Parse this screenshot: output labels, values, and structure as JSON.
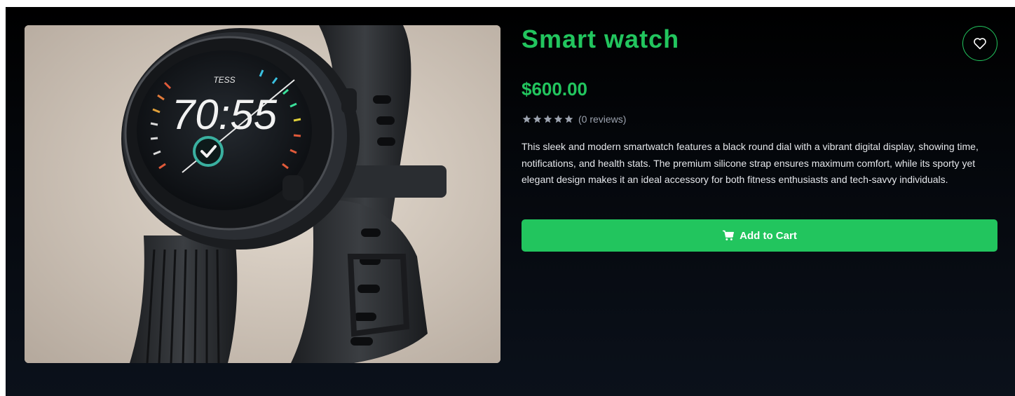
{
  "product": {
    "title": "Smart watch",
    "price": "$600.00",
    "rating": 0,
    "max_rating": 5,
    "reviews_text": "(0 reviews)",
    "description": "This sleek and modern smartwatch features a black round dial with a vibrant digital display, showing time, notifications, and health stats. The premium silicone strap ensures maximum comfort, while its sporty yet elegant design makes it an ideal accessory for both fitness enthusiasts and tech-savvy individuals.",
    "image": {
      "watch_time": "70:55",
      "watch_brand": "TESS"
    }
  },
  "actions": {
    "add_to_cart_label": "Add to Cart"
  },
  "icons": {
    "wishlist": "heart-icon",
    "cart": "shopping-cart-icon",
    "star": "star-icon"
  },
  "colors": {
    "accent": "#22c55e",
    "background": "#05080d",
    "star_gray": "#9ca3af"
  }
}
